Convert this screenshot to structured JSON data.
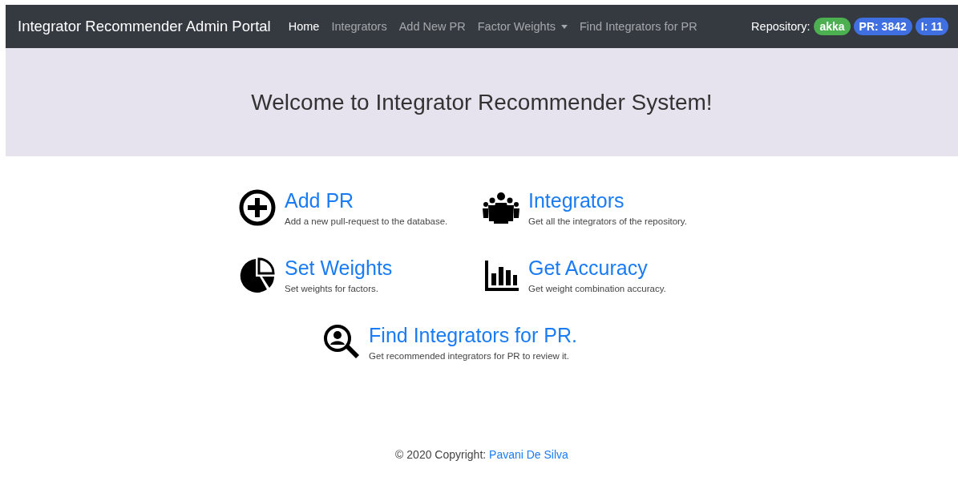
{
  "navbar": {
    "brand": "Integrator Recommender Admin Portal",
    "items": [
      {
        "label": "Home",
        "selected": true,
        "kind": "link"
      },
      {
        "label": "Integrators",
        "selected": false,
        "kind": "link"
      },
      {
        "label": "Add New PR",
        "selected": false,
        "kind": "link"
      },
      {
        "label": "Factor Weights",
        "selected": false,
        "kind": "dropdown"
      },
      {
        "label": "Find Integrators for PR",
        "selected": false,
        "kind": "link"
      }
    ],
    "repository_label": "Repository:",
    "badges": [
      {
        "text": "akka",
        "color": "#4caf50"
      },
      {
        "text": "PR: 3842",
        "color": "#3f6fe0"
      },
      {
        "text": "I: 11",
        "color": "#3f6fe0"
      }
    ]
  },
  "jumbotron": {
    "heading": "Welcome to Integrator Recommender System!"
  },
  "features": [
    {
      "kind": "plus",
      "title": "Add PR",
      "description": "Add a new pull-request to the database."
    },
    {
      "kind": "people",
      "title": "Integrators",
      "description": "Get all the integrators of the repository."
    },
    {
      "kind": "pie",
      "title": "Set Weights",
      "description": "Set weights for factors."
    },
    {
      "kind": "bars",
      "title": "Get Accuracy",
      "description": "Get weight combination accuracy."
    },
    {
      "kind": "search-person",
      "title": "Find Integrators for PR.",
      "description": "Get recommended integrators for PR to review it."
    }
  ],
  "footer": {
    "text": "© 2020 Copyright:",
    "link": "Pavani De Silva"
  }
}
